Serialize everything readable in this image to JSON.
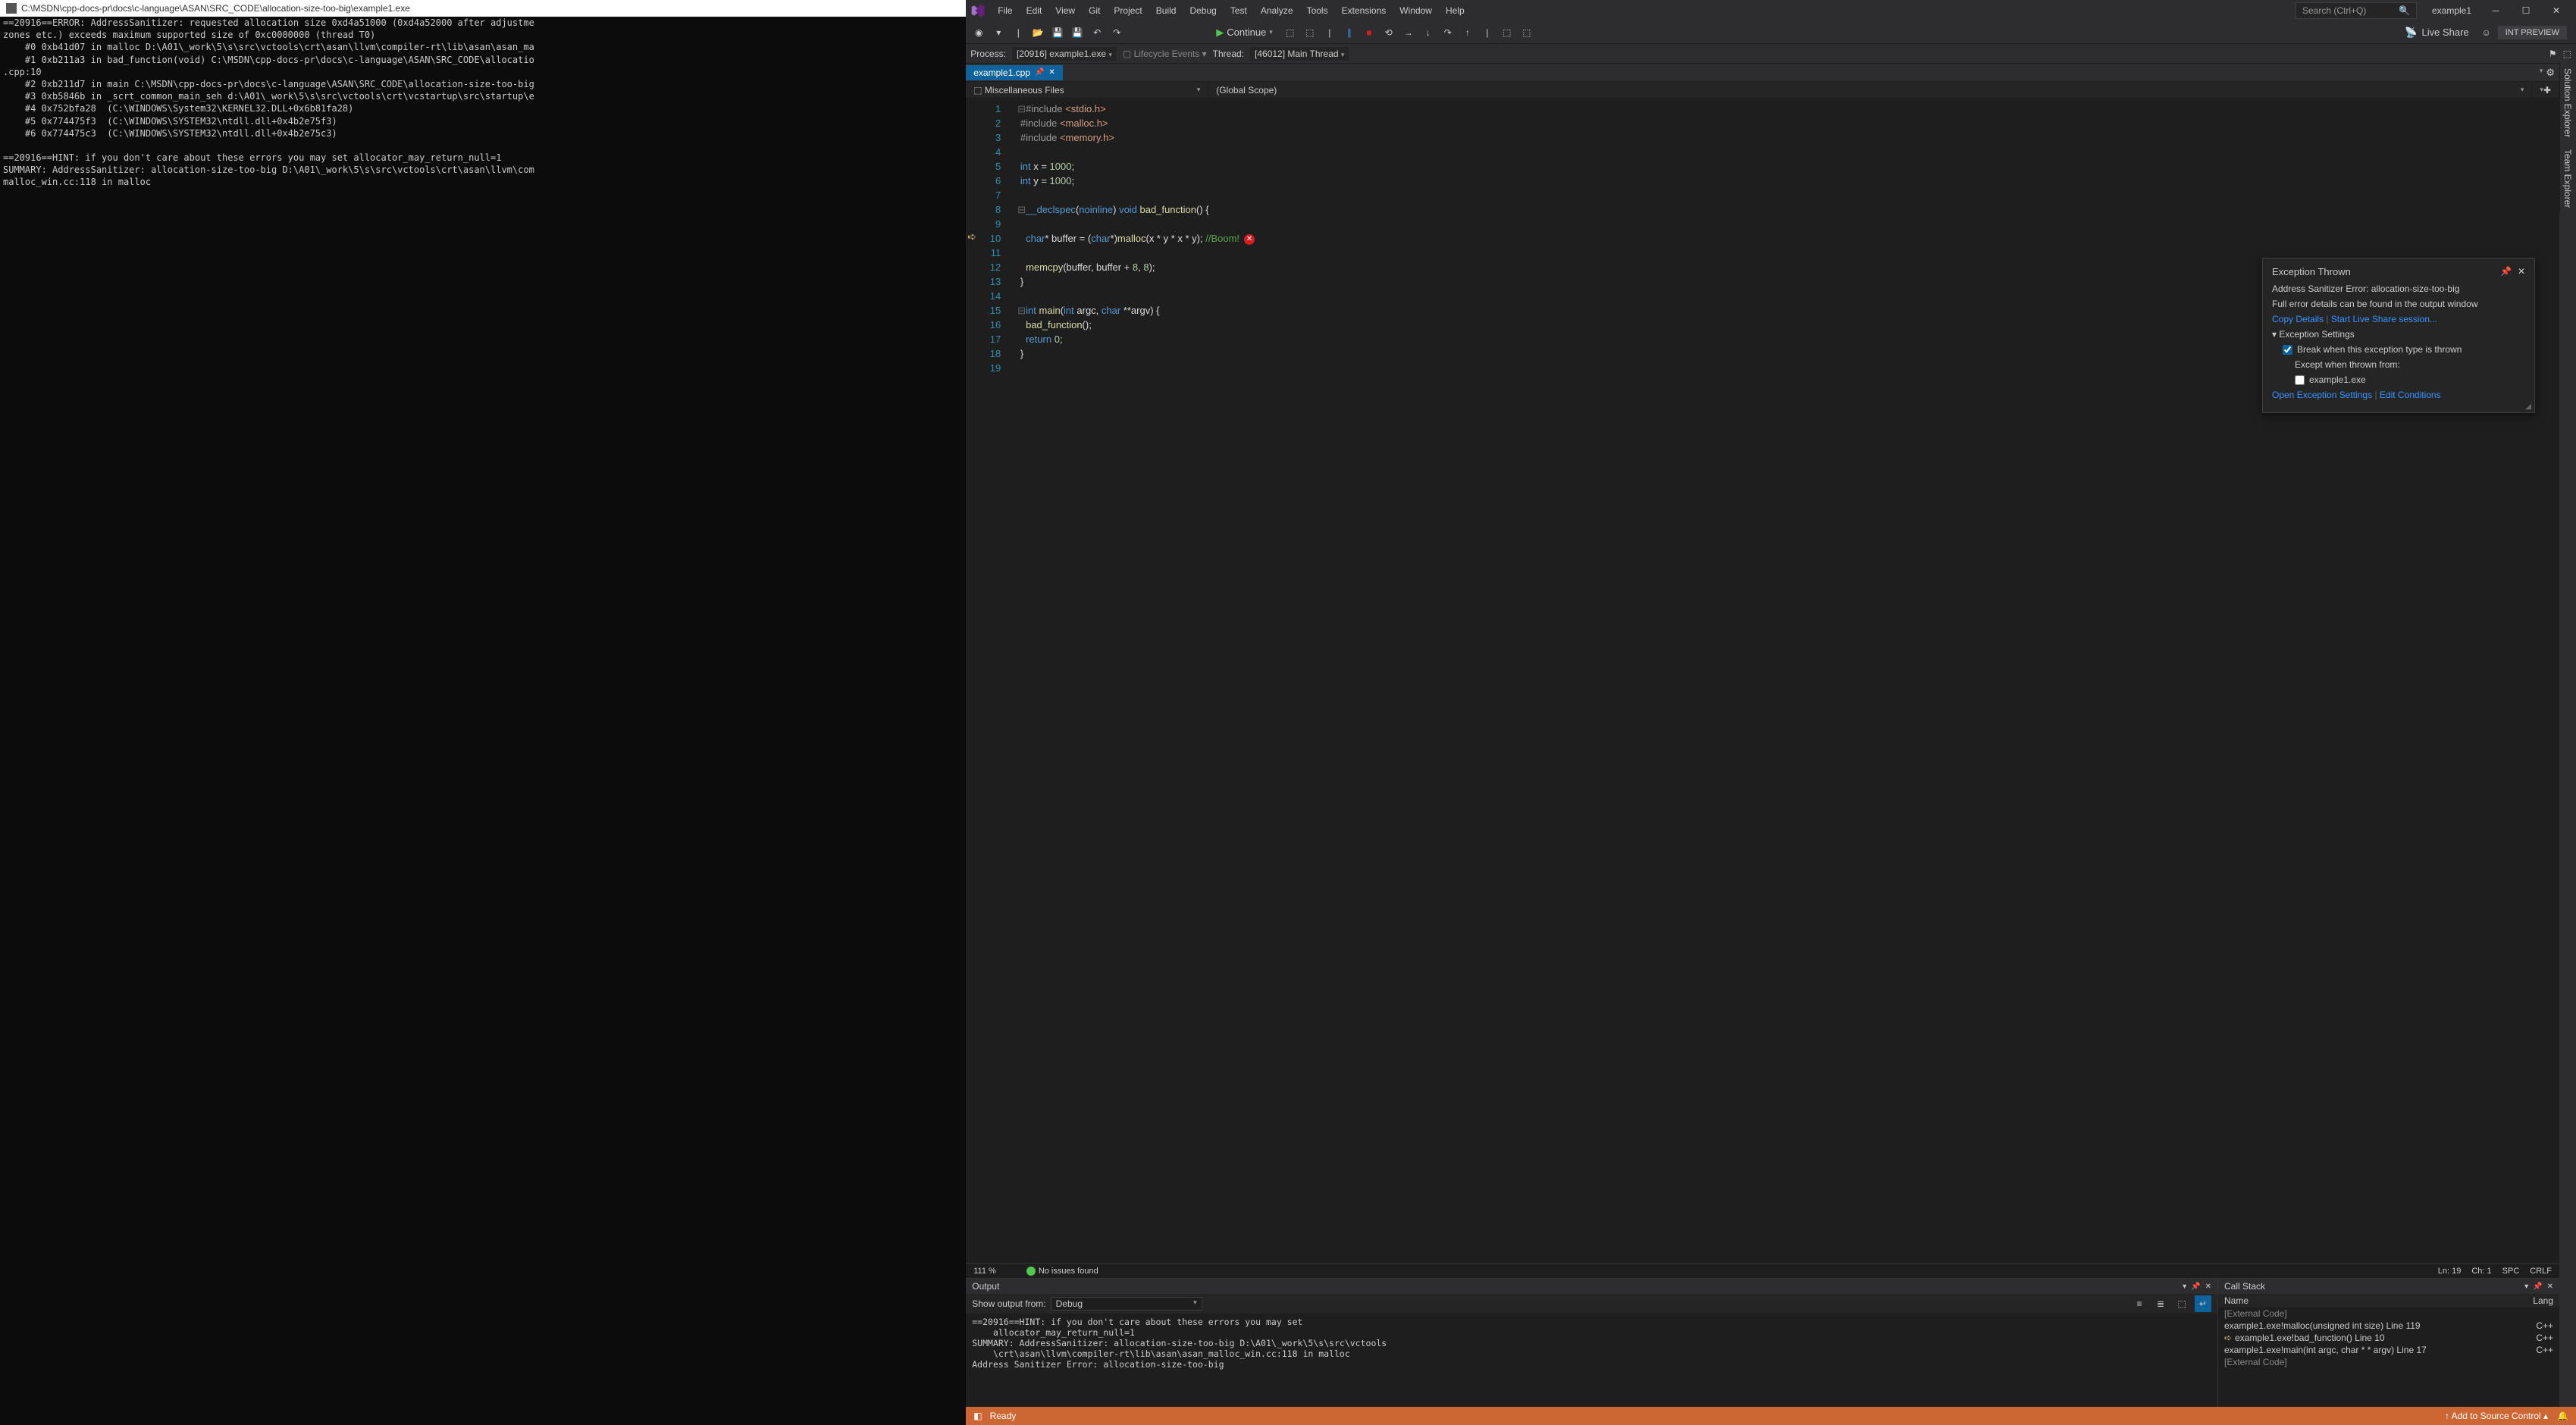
{
  "console": {
    "title": "C:\\MSDN\\cpp-docs-pr\\docs\\c-language\\ASAN\\SRC_CODE\\allocation-size-too-big\\example1.exe",
    "body": "==20916==ERROR: AddressSanitizer: requested allocation size 0xd4a51000 (0xd4a52000 after adjustme\nzones etc.) exceeds maximum supported size of 0xc0000000 (thread T0)\n    #0 0xb41d07 in malloc D:\\A01\\_work\\5\\s\\src\\vctools\\crt\\asan\\llvm\\compiler-rt\\lib\\asan\\asan_ma\n    #1 0xb211a3 in bad_function(void) C:\\MSDN\\cpp-docs-pr\\docs\\c-language\\ASAN\\SRC_CODE\\allocatio\n.cpp:10\n    #2 0xb211d7 in main C:\\MSDN\\cpp-docs-pr\\docs\\c-language\\ASAN\\SRC_CODE\\allocation-size-too-big\n    #3 0xb5846b in _scrt_common_main_seh d:\\A01\\_work\\5\\s\\src\\vctools\\crt\\vcstartup\\src\\startup\\e\n    #4 0x752bfa28  (C:\\WINDOWS\\System32\\KERNEL32.DLL+0x6b81fa28)\n    #5 0x774475f3  (C:\\WINDOWS\\SYSTEM32\\ntdll.dll+0x4b2e75f3)\n    #6 0x774475c3  (C:\\WINDOWS\\SYSTEM32\\ntdll.dll+0x4b2e75c3)\n\n==20916==HINT: if you don't care about these errors you may set allocator_may_return_null=1\nSUMMARY: AddressSanitizer: allocation-size-too-big D:\\A01\\_work\\5\\s\\src\\vctools\\crt\\asan\\llvm\\com\nmalloc_win.cc:118 in malloc"
  },
  "vs": {
    "menu": [
      "File",
      "Edit",
      "View",
      "Git",
      "Project",
      "Build",
      "Debug",
      "Test",
      "Analyze",
      "Tools",
      "Extensions",
      "Window",
      "Help"
    ],
    "search_placeholder": "Search (Ctrl+Q)",
    "solution": "example1",
    "int_preview": "INT PREVIEW",
    "continue_label": "Continue",
    "liveshare_label": "Live Share",
    "process_label": "Process:",
    "process_value": "[20916] example1.exe",
    "lifecycle_label": "Lifecycle Events",
    "thread_label": "Thread:",
    "thread_value": "[46012] Main Thread",
    "right_tabs": [
      "Solution Explorer",
      "Team Explorer"
    ],
    "doctab": "example1.cpp",
    "nav_left": "Miscellaneous Files",
    "nav_right": "(Global Scope)",
    "code_lines": [
      "<span class='outline-box'>⊟</span><span class='tk-macro'>#include</span> <span class='tk-string'>&lt;stdio.h&gt;</span>",
      " <span class='tk-macro'>#include</span> <span class='tk-string'>&lt;malloc.h&gt;</span>",
      " <span class='tk-macro'>#include</span> <span class='tk-string'>&lt;memory.h&gt;</span>",
      " ",
      " <span class='tk-type'>int</span> x = <span class='tk-number'>1000</span>;",
      " <span class='tk-type'>int</span> y = <span class='tk-number'>1000</span>;",
      " ",
      "<span class='outline-box'>⊟</span><span class='tk-keyword'>__declspec</span>(<span class='tk-keyword'>noinline</span>) <span class='tk-type'>void</span> <span class='tk-func'>bad_function</span>() {",
      " ",
      "   <span class='tk-type'>char</span>* buffer = (<span class='tk-type'>char</span>*)<span class='tk-func'>malloc</span>(x * y * x * y); <span class='tk-comment'>//Boom!</span><span class='err-marker'>✕</span>",
      " ",
      "   <span class='tk-func'>memcpy</span>(buffer, buffer + <span class='tk-number'>8</span>, <span class='tk-number'>8</span>);",
      " }",
      " ",
      "<span class='outline-box'>⊟</span><span class='tk-type'>int</span> <span class='tk-func'>main</span>(<span class='tk-type'>int</span> argc, <span class='tk-type'>char</span> **argv) {",
      "   <span class='tk-func'>bad_function</span>();",
      "   <span class='tk-keyword'>return</span> <span class='tk-number'>0</span>;",
      " }",
      " "
    ],
    "popup": {
      "title": "Exception Thrown",
      "error": "Address Sanitizer Error: allocation-size-too-big",
      "details": "Full error details can be found in the output window",
      "copy": "Copy Details",
      "liveshare": "Start Live Share session...",
      "settings_header": "Exception Settings",
      "break_label": "Break when this exception type is thrown",
      "except_label": "Except when thrown from:",
      "except_item": "example1.exe",
      "open_settings": "Open Exception Settings",
      "edit_conditions": "Edit Conditions"
    },
    "status": {
      "zoom": "111 %",
      "issues": "No issues found",
      "ln": "Ln: 19",
      "ch": "Ch: 1",
      "spc": "SPC",
      "crlf": "CRLF"
    },
    "output": {
      "title": "Output",
      "show_label": "Show output from:",
      "show_value": "Debug",
      "body": "==20916==HINT: if you don't care about these errors you may set\n    allocator_may_return_null=1\nSUMMARY: AddressSanitizer: allocation-size-too-big D:\\A01\\_work\\5\\s\\src\\vctools\n    \\crt\\asan\\llvm\\compiler-rt\\lib\\asan\\asan_malloc_win.cc:118 in malloc\nAddress Sanitizer Error: allocation-size-too-big"
    },
    "callstack": {
      "title": "Call Stack",
      "col_name": "Name",
      "col_lang": "Lang",
      "rows": [
        {
          "name": "[External Code]",
          "lang": "",
          "ext": true,
          "curr": false
        },
        {
          "name": "example1.exe!malloc(unsigned int size) Line 119",
          "lang": "C++",
          "ext": false,
          "curr": false
        },
        {
          "name": "example1.exe!bad_function() Line 10",
          "lang": "C++",
          "ext": false,
          "curr": true
        },
        {
          "name": "example1.exe!main(int argc, char * * argv) Line 17",
          "lang": "C++",
          "ext": false,
          "curr": false
        },
        {
          "name": "[External Code]",
          "lang": "",
          "ext": true,
          "curr": false
        }
      ]
    },
    "bottombar": {
      "ready": "Ready",
      "source_control": "Add to Source Control"
    }
  }
}
